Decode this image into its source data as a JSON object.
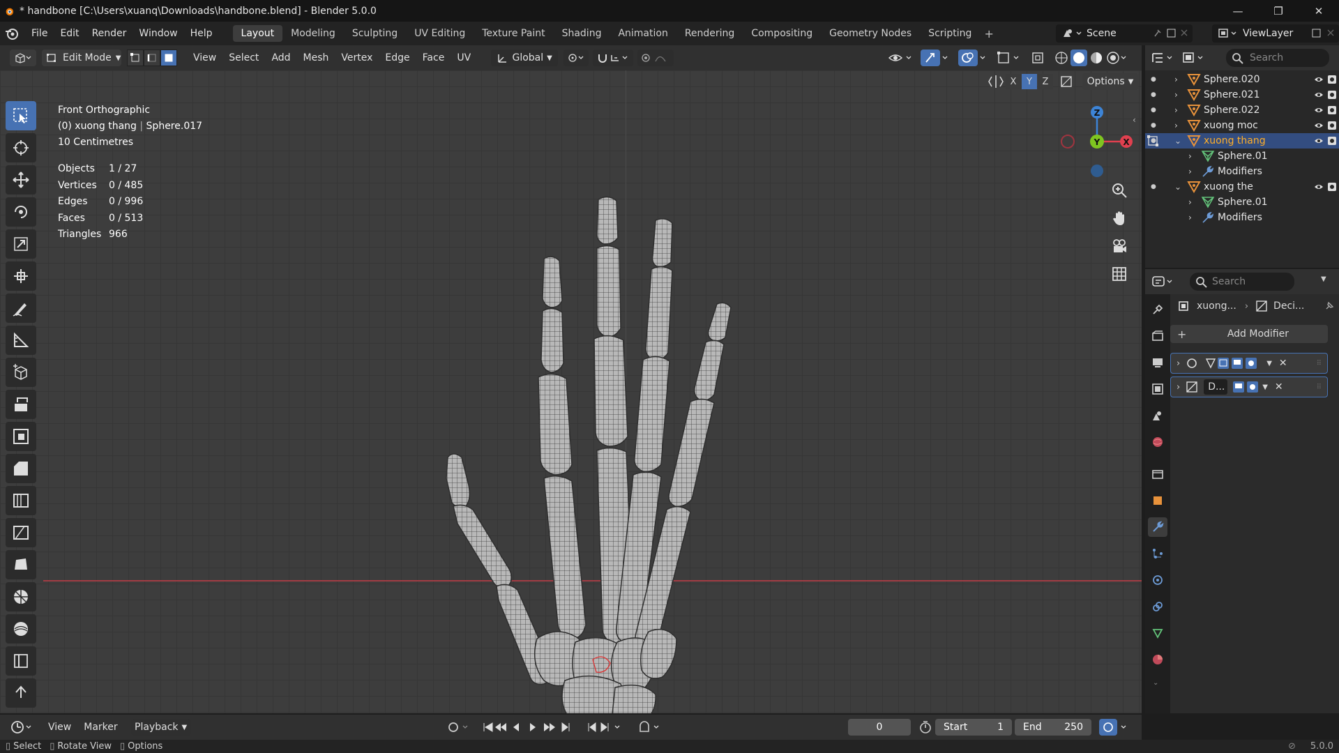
{
  "titlebar": {
    "title": "* handbone [C:\\Users\\xuanq\\Downloads\\handbone.blend] - Blender 5.0.0",
    "minimize": "—",
    "maximize": "❐",
    "close": "✕"
  },
  "menubar": {
    "menus": [
      "File",
      "Edit",
      "Render",
      "Window",
      "Help"
    ],
    "workspaces": [
      "Layout",
      "Modeling",
      "Sculpting",
      "UV Editing",
      "Texture Paint",
      "Shading",
      "Animation",
      "Rendering",
      "Compositing",
      "Geometry Nodes",
      "Scripting"
    ],
    "active_workspace": "Layout",
    "add_workspace": "+",
    "scene": "Scene",
    "view_layer": "ViewLayer"
  },
  "viewport_header": {
    "mode": "Edit Mode",
    "menus": [
      "View",
      "Select",
      "Add",
      "Mesh",
      "Vertex",
      "Edge",
      "Face",
      "UV"
    ],
    "orientation": "Global",
    "options": "Options",
    "axes": [
      "X",
      "Y",
      "Z"
    ]
  },
  "viewport": {
    "view_name": "Front Orthographic",
    "object_line_a": "(0) xuong thang",
    "object_line_b": "Sphere.017",
    "scale": "10 Centimetres",
    "stats": [
      {
        "k": "Objects",
        "v": "1 / 27"
      },
      {
        "k": "Vertices",
        "v": "0 / 485"
      },
      {
        "k": "Edges",
        "v": "0 / 996"
      },
      {
        "k": "Faces",
        "v": "0 / 513"
      },
      {
        "k": "Triangles",
        "v": "966"
      }
    ],
    "gizmo": {
      "x": "X",
      "y": "Y",
      "z": "Z"
    }
  },
  "outliner": {
    "search_placeholder": "Search",
    "rows": [
      {
        "label": "Sphere.020",
        "kind": "object",
        "indent": 0,
        "selected": false
      },
      {
        "label": "Sphere.021",
        "kind": "object",
        "indent": 0,
        "selected": false
      },
      {
        "label": "Sphere.022",
        "kind": "object",
        "indent": 0,
        "selected": false
      },
      {
        "label": "xuong moc",
        "kind": "object",
        "indent": 0,
        "selected": false
      },
      {
        "label": "xuong thang",
        "kind": "object",
        "indent": 0,
        "selected": true
      },
      {
        "label": "Sphere.01",
        "kind": "mesh",
        "indent": 1,
        "selected": false
      },
      {
        "label": "Modifiers",
        "kind": "modifier",
        "indent": 1,
        "selected": false
      },
      {
        "label": "xuong the",
        "kind": "object",
        "indent": 0,
        "selected": false
      },
      {
        "label": "Sphere.01",
        "kind": "mesh",
        "indent": 1,
        "selected": false
      },
      {
        "label": "Modifiers",
        "kind": "modifier",
        "indent": 1,
        "selected": false
      }
    ]
  },
  "properties": {
    "search_placeholder": "Search",
    "breadcrumb_object": "xuong...",
    "breadcrumb_modifier": "Deci...",
    "add_modifier": "Add Modifier",
    "modifier_2_name": "D..."
  },
  "timeline": {
    "menus": [
      "View",
      "Marker",
      "Playback"
    ],
    "current_frame": "0",
    "start_label": "Start",
    "start_value": "1",
    "end_label": "End",
    "end_value": "250"
  },
  "statusbar": {
    "select": "Select",
    "rotate": "Rotate View",
    "options": "Options",
    "version": "5.0.0"
  },
  "colors": {
    "accent": "#4772b3",
    "selected_text": "#ffaf29",
    "object_icon": "#e8923b",
    "mesh_icon": "#63c37a",
    "modifier_icon": "#6d9bd6",
    "x_axis": "#e0404f",
    "y_axis": "#7fc520",
    "z_axis": "#3d84d6"
  }
}
